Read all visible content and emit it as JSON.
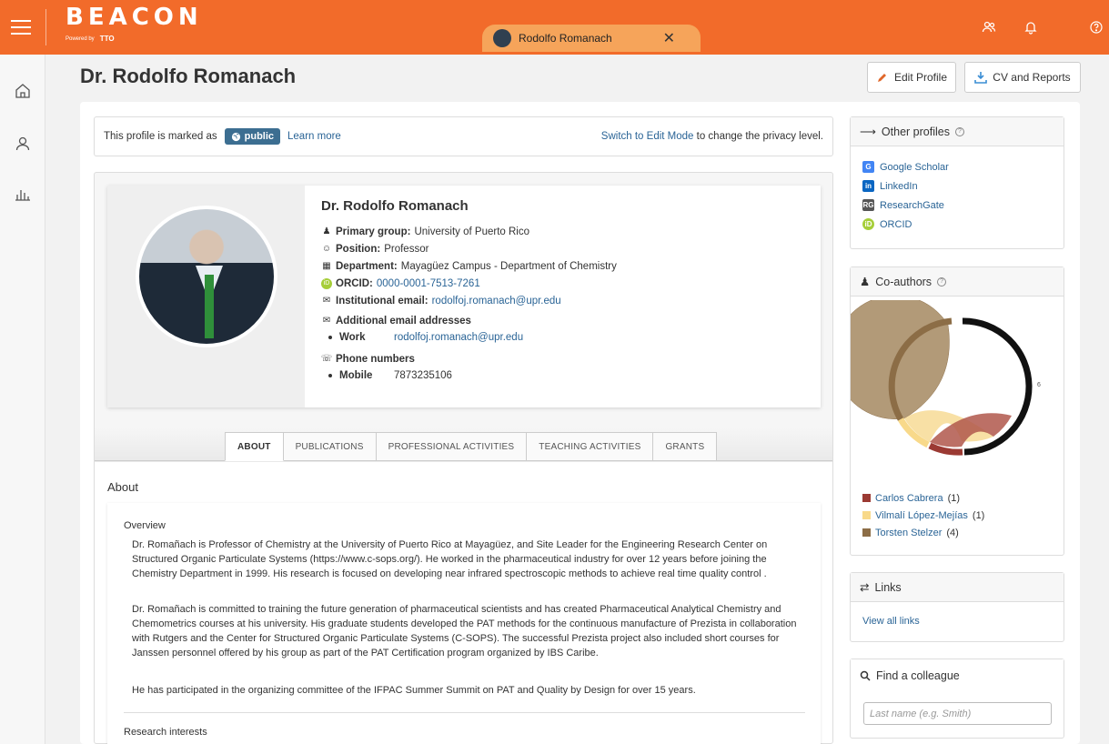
{
  "header": {
    "logo": "BEACON",
    "logo_powered": "Powered by",
    "logo_tto": "TTO",
    "open_tab_label": "Rodolfo Romanach",
    "close_symbol": "✕"
  },
  "page": {
    "title": "Dr. Rodolfo Romanach",
    "edit_profile_label": "Edit Profile",
    "cv_reports_label": "CV and Reports"
  },
  "privacy": {
    "prefix": "This profile is marked as",
    "badge": "public",
    "learn_more": "Learn more",
    "switch_link": "Switch to Edit Mode",
    "switch_suffix": " to change the privacy level."
  },
  "profile": {
    "name": "Dr. Rodolfo Romanach",
    "primary_group_label": "Primary group:",
    "primary_group": "University of Puerto Rico",
    "position_label": "Position:",
    "position": "Professor",
    "department_label": "Department:",
    "department": "Mayagüez Campus - Department of Chemistry",
    "orcid_label": "ORCID:",
    "orcid": "0000-0001-7513-7261",
    "inst_email_label": "Institutional email:",
    "inst_email": "rodolfoj.romanach@upr.edu",
    "add_email_label": "Additional email addresses",
    "add_email_type": "Work",
    "add_email": "rodolfoj.romanach@upr.edu",
    "phone_label": "Phone numbers",
    "phone_type": "Mobile",
    "phone": "7873235106"
  },
  "tabs": [
    "ABOUT",
    "PUBLICATIONS",
    "PROFESSIONAL ACTIVITIES",
    "TEACHING ACTIVITIES",
    "GRANTS"
  ],
  "about": {
    "heading": "About",
    "overview_heading": "Overview",
    "p1": "Dr. Romañach is Professor of Chemistry at the University of Puerto Rico at Mayagüez, and Site Leader for the Engineering Research Center on Structured Organic Particulate Systems (https://www.c-sops.org/). He worked in the pharmaceutical industry for over 12 years before joining the Chemistry Department in 1999. His research is focused on developing near infrared spectroscopic methods to achieve real time quality control .",
    "p2": "Dr. Romañach is committed to training the future generation of pharmaceutical scientists and has created Pharmaceutical Analytical Chemistry and Chemometrics courses at his university. His graduate students developed the PAT methods for the continuous manufacture of Prezista in collaboration with Rutgers and the Center for Structured Organic Particulate Systems (C-SOPS). The successful Prezista project also included short courses for Janssen personnel offered by his group as part of the PAT Certification program organized by IBS Caribe.",
    "p3": "He has participated in the organizing committee of the IFPAC Summer Summit on PAT and Quality by Design for over 15 years.",
    "research_heading": "Research interests"
  },
  "sidebar": {
    "other_profiles_title": "Other profiles",
    "profiles": [
      {
        "label": "Google Scholar",
        "icon": "google-scholar-icon",
        "color": "#4285f4"
      },
      {
        "label": "LinkedIn",
        "icon": "linkedin-icon",
        "color": "#0a66c2"
      },
      {
        "label": "ResearchGate",
        "icon": "researchgate-icon",
        "color": "#555555"
      },
      {
        "label": "ORCID",
        "icon": "orcid-icon",
        "color": "#a6ce39"
      }
    ],
    "coauthors_title": "Co-authors",
    "chord_labels": [
      "6"
    ],
    "coauthors": [
      {
        "name": "Carlos Cabrera",
        "count": "(1)",
        "color": "#9b3a33"
      },
      {
        "name": "Vilmalí López-Mejías",
        "count": "(1)",
        "color": "#f8d98a"
      },
      {
        "name": "Torsten Stelzer",
        "count": "(4)",
        "color": "#8c6d46"
      }
    ],
    "links_title": "Links",
    "view_all_links": "View all links",
    "find_title": "Find a colleague",
    "find_placeholder": "Last name (e.g. Smith)"
  }
}
